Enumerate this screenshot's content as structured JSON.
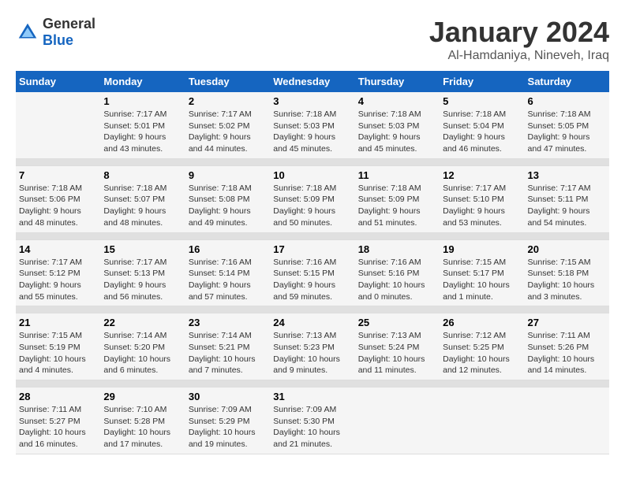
{
  "header": {
    "logo_general": "General",
    "logo_blue": "Blue",
    "month_title": "January 2024",
    "location": "Al-Hamdaniya, Nineveh, Iraq"
  },
  "days_of_week": [
    "Sunday",
    "Monday",
    "Tuesday",
    "Wednesday",
    "Thursday",
    "Friday",
    "Saturday"
  ],
  "weeks": [
    [
      {
        "day": "",
        "info": ""
      },
      {
        "day": "1",
        "info": "Sunrise: 7:17 AM\nSunset: 5:01 PM\nDaylight: 9 hours\nand 43 minutes."
      },
      {
        "day": "2",
        "info": "Sunrise: 7:17 AM\nSunset: 5:02 PM\nDaylight: 9 hours\nand 44 minutes."
      },
      {
        "day": "3",
        "info": "Sunrise: 7:18 AM\nSunset: 5:03 PM\nDaylight: 9 hours\nand 45 minutes."
      },
      {
        "day": "4",
        "info": "Sunrise: 7:18 AM\nSunset: 5:03 PM\nDaylight: 9 hours\nand 45 minutes."
      },
      {
        "day": "5",
        "info": "Sunrise: 7:18 AM\nSunset: 5:04 PM\nDaylight: 9 hours\nand 46 minutes."
      },
      {
        "day": "6",
        "info": "Sunrise: 7:18 AM\nSunset: 5:05 PM\nDaylight: 9 hours\nand 47 minutes."
      }
    ],
    [
      {
        "day": "7",
        "info": "Sunrise: 7:18 AM\nSunset: 5:06 PM\nDaylight: 9 hours\nand 48 minutes."
      },
      {
        "day": "8",
        "info": "Sunrise: 7:18 AM\nSunset: 5:07 PM\nDaylight: 9 hours\nand 48 minutes."
      },
      {
        "day": "9",
        "info": "Sunrise: 7:18 AM\nSunset: 5:08 PM\nDaylight: 9 hours\nand 49 minutes."
      },
      {
        "day": "10",
        "info": "Sunrise: 7:18 AM\nSunset: 5:09 PM\nDaylight: 9 hours\nand 50 minutes."
      },
      {
        "day": "11",
        "info": "Sunrise: 7:18 AM\nSunset: 5:09 PM\nDaylight: 9 hours\nand 51 minutes."
      },
      {
        "day": "12",
        "info": "Sunrise: 7:17 AM\nSunset: 5:10 PM\nDaylight: 9 hours\nand 53 minutes."
      },
      {
        "day": "13",
        "info": "Sunrise: 7:17 AM\nSunset: 5:11 PM\nDaylight: 9 hours\nand 54 minutes."
      }
    ],
    [
      {
        "day": "14",
        "info": "Sunrise: 7:17 AM\nSunset: 5:12 PM\nDaylight: 9 hours\nand 55 minutes."
      },
      {
        "day": "15",
        "info": "Sunrise: 7:17 AM\nSunset: 5:13 PM\nDaylight: 9 hours\nand 56 minutes."
      },
      {
        "day": "16",
        "info": "Sunrise: 7:16 AM\nSunset: 5:14 PM\nDaylight: 9 hours\nand 57 minutes."
      },
      {
        "day": "17",
        "info": "Sunrise: 7:16 AM\nSunset: 5:15 PM\nDaylight: 9 hours\nand 59 minutes."
      },
      {
        "day": "18",
        "info": "Sunrise: 7:16 AM\nSunset: 5:16 PM\nDaylight: 10 hours\nand 0 minutes."
      },
      {
        "day": "19",
        "info": "Sunrise: 7:15 AM\nSunset: 5:17 PM\nDaylight: 10 hours\nand 1 minute."
      },
      {
        "day": "20",
        "info": "Sunrise: 7:15 AM\nSunset: 5:18 PM\nDaylight: 10 hours\nand 3 minutes."
      }
    ],
    [
      {
        "day": "21",
        "info": "Sunrise: 7:15 AM\nSunset: 5:19 PM\nDaylight: 10 hours\nand 4 minutes."
      },
      {
        "day": "22",
        "info": "Sunrise: 7:14 AM\nSunset: 5:20 PM\nDaylight: 10 hours\nand 6 minutes."
      },
      {
        "day": "23",
        "info": "Sunrise: 7:14 AM\nSunset: 5:21 PM\nDaylight: 10 hours\nand 7 minutes."
      },
      {
        "day": "24",
        "info": "Sunrise: 7:13 AM\nSunset: 5:23 PM\nDaylight: 10 hours\nand 9 minutes."
      },
      {
        "day": "25",
        "info": "Sunrise: 7:13 AM\nSunset: 5:24 PM\nDaylight: 10 hours\nand 11 minutes."
      },
      {
        "day": "26",
        "info": "Sunrise: 7:12 AM\nSunset: 5:25 PM\nDaylight: 10 hours\nand 12 minutes."
      },
      {
        "day": "27",
        "info": "Sunrise: 7:11 AM\nSunset: 5:26 PM\nDaylight: 10 hours\nand 14 minutes."
      }
    ],
    [
      {
        "day": "28",
        "info": "Sunrise: 7:11 AM\nSunset: 5:27 PM\nDaylight: 10 hours\nand 16 minutes."
      },
      {
        "day": "29",
        "info": "Sunrise: 7:10 AM\nSunset: 5:28 PM\nDaylight: 10 hours\nand 17 minutes."
      },
      {
        "day": "30",
        "info": "Sunrise: 7:09 AM\nSunset: 5:29 PM\nDaylight: 10 hours\nand 19 minutes."
      },
      {
        "day": "31",
        "info": "Sunrise: 7:09 AM\nSunset: 5:30 PM\nDaylight: 10 hours\nand 21 minutes."
      },
      {
        "day": "",
        "info": ""
      },
      {
        "day": "",
        "info": ""
      },
      {
        "day": "",
        "info": ""
      }
    ]
  ]
}
